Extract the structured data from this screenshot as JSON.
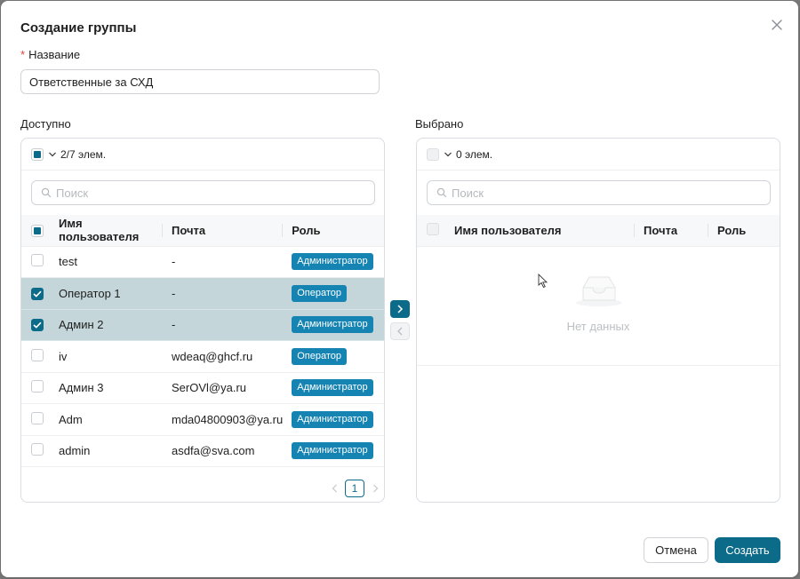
{
  "dialog": {
    "title": "Создание группы",
    "name_label": "Название",
    "name_value": "Ответственные за СХД",
    "cancel_label": "Отмена",
    "create_label": "Создать"
  },
  "available": {
    "label": "Доступно",
    "count": "2/7 элем.",
    "search_placeholder": "Поиск",
    "columns": [
      "Имя пользователя",
      "Почта",
      "Роль"
    ],
    "rows": [
      {
        "name": "test",
        "email": "-",
        "role": "Администратор",
        "selected": false
      },
      {
        "name": "Оператор 1",
        "email": "-",
        "role": "Оператор",
        "selected": true
      },
      {
        "name": "Админ 2",
        "email": "-",
        "role": "Администратор",
        "selected": true
      },
      {
        "name": "iv",
        "email": "wdeaq@ghcf.ru",
        "role": "Оператор",
        "selected": false
      },
      {
        "name": "Админ 3",
        "email": "SerOVl@ya.ru",
        "role": "Администратор",
        "selected": false
      },
      {
        "name": "Adm",
        "email": "mda04800903@ya.ru",
        "role": "Администратор",
        "selected": false
      },
      {
        "name": "admin",
        "email": "asdfa@sva.com",
        "role": "Администратор",
        "selected": false
      }
    ],
    "page": "1"
  },
  "selected": {
    "label": "Выбрано",
    "count": "0 элем.",
    "search_placeholder": "Поиск",
    "columns": [
      "Имя пользователя",
      "Почта",
      "Роль"
    ],
    "empty_text": "Нет данных"
  },
  "colors": {
    "accent": "#0d6b8a",
    "badge": "#1684b3",
    "selected_row": "#c4d6d9",
    "required": "#e0443a"
  }
}
